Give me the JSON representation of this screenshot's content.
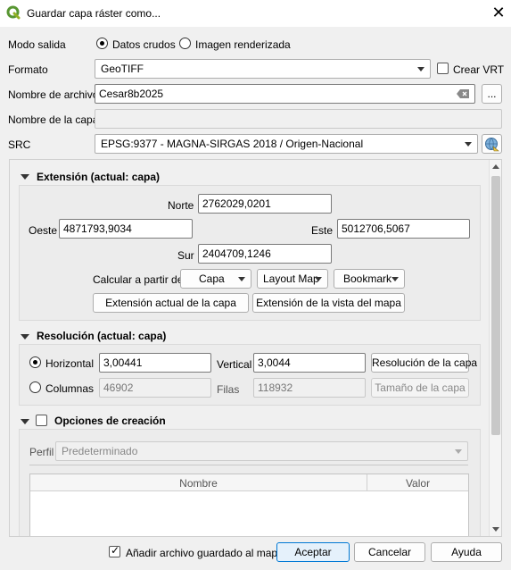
{
  "window": {
    "title": "Guardar capa ráster como..."
  },
  "output_mode": {
    "label": "Modo salida",
    "options": [
      "Datos crudos",
      "Imagen renderizada"
    ],
    "selected": "Datos crudos"
  },
  "format": {
    "label": "Formato",
    "value": "GeoTIFF",
    "vrt_label": "Crear VRT",
    "vrt_checked": false
  },
  "filename": {
    "label": "Nombre de archivo",
    "value": "Cesar8b2025",
    "browse_label": "..."
  },
  "layer_name": {
    "label": "Nombre de la capa",
    "value": ""
  },
  "crs": {
    "label": "SRC",
    "value": "EPSG:9377 - MAGNA-SIRGAS 2018 / Origen-Nacional"
  },
  "extent": {
    "title": "Extensión (actual: capa)",
    "north_label": "Norte",
    "north": "2762029,0201",
    "west_label": "Oeste",
    "west": "4871793,9034",
    "east_label": "Este",
    "east": "5012706,5067",
    "south_label": "Sur",
    "south": "2404709,1246",
    "calc_label": "Calcular a partir de",
    "calc_layer": "Capa",
    "calc_layout": "Layout Map",
    "calc_bookmark": "Bookmark",
    "current_layer_extent": "Extensión actual de la capa",
    "map_view_extent": "Extensión de la vista del mapa"
  },
  "resolution": {
    "title": "Resolución (actual: capa)",
    "horizontal_label": "Horizontal",
    "horizontal": "3,00441",
    "vertical_label": "Vertical",
    "vertical": "3,0044",
    "layer_resolution_button": "Resolución de la capa",
    "columns_label": "Columnas",
    "columns": "46902",
    "rows_label": "Filas",
    "rows": "118932",
    "layer_size_button": "Tamaño de la capa",
    "selected": "Horizontal"
  },
  "creation_options": {
    "title": "Opciones de creación",
    "checked": false,
    "profile_label": "Perfil",
    "profile_value": "Predeterminado",
    "table_headers": [
      "Nombre",
      "Valor"
    ]
  },
  "footer": {
    "add_to_map_label": "Añadir archivo guardado al mapa",
    "add_to_map_checked": true,
    "accept": "Aceptar",
    "cancel": "Cancelar",
    "help": "Ayuda"
  }
}
